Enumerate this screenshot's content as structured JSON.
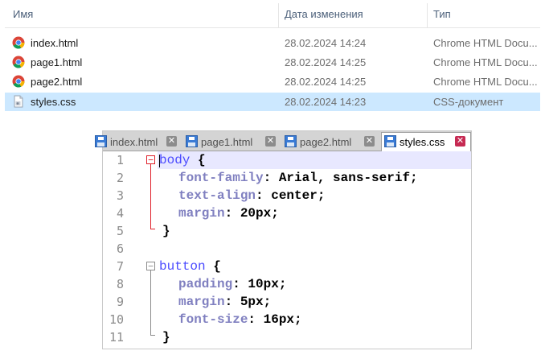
{
  "explorer": {
    "columns": {
      "name": "Имя",
      "date": "Дата изменения",
      "type": "Тип"
    },
    "files": [
      {
        "name": "index.html",
        "date": "28.02.2024 14:24",
        "type": "Chrome HTML Docu...",
        "icon": "chrome-icon",
        "selected": false
      },
      {
        "name": "page1.html",
        "date": "28.02.2024 14:25",
        "type": "Chrome HTML Docu...",
        "icon": "chrome-icon",
        "selected": false
      },
      {
        "name": "page2.html",
        "date": "28.02.2024 14:25",
        "type": "Chrome HTML Docu...",
        "icon": "chrome-icon",
        "selected": false
      },
      {
        "name": "styles.css",
        "date": "28.02.2024 14:23",
        "type": "CSS-документ",
        "icon": "css-file-icon",
        "selected": true
      }
    ],
    "selected_color": "#cce8ff"
  },
  "editor": {
    "tabs": [
      {
        "label": "index.html",
        "active": false
      },
      {
        "label": "page1.html",
        "active": false
      },
      {
        "label": "page2.html",
        "active": false
      },
      {
        "label": "styles.css",
        "active": true
      }
    ],
    "tab_close_glyph": "✕",
    "line_numbers": [
      "1",
      "2",
      "3",
      "4",
      "5",
      "6",
      "7",
      "8",
      "9",
      "10",
      "11"
    ],
    "code": {
      "l1_selector": "body",
      "l1_brace": " {",
      "l2_prop": "font-family",
      "l2_val": ": Arial, sans-serif;",
      "l3_prop": "text-align",
      "l3_val": ": center;",
      "l4_prop": "margin",
      "l4_val": ": 20px;",
      "l5": "}",
      "l7_selector": "button",
      "l7_brace": " {",
      "l8_prop": "padding",
      "l8_val": ": 10px;",
      "l9_prop": "margin",
      "l9_val": ": 5px;",
      "l10_prop": "font-size",
      "l10_val": ": 16px;",
      "l11": "}"
    },
    "colors": {
      "selector": "#4b4bff",
      "property": "#8080c0",
      "current_line": "#e8e8ff",
      "fold_active": "#e0202a",
      "fold_inactive": "#8c8c8c"
    }
  }
}
